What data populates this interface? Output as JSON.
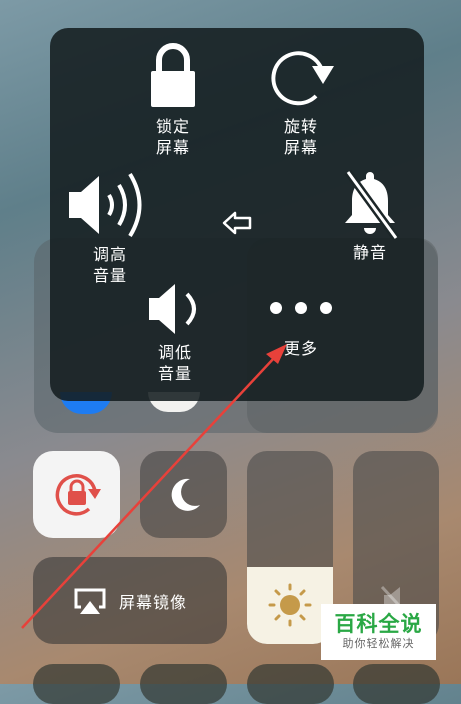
{
  "assistive_menu": {
    "lock_screen_label": "锁定\n屏幕",
    "rotate_screen_label": "旋转\n屏幕",
    "volume_up_label": "调高\n音量",
    "mute_label": "静音",
    "volume_down_label": "调低\n音量",
    "more_label": "更多"
  },
  "control_center": {
    "screen_mirroring_label": "屏幕镜像",
    "brightness_level": 0.4,
    "volume_level": 0.0
  },
  "watermark": {
    "title": "百科全说",
    "subtitle": "助你轻松解决"
  },
  "colors": {
    "annotation_arrow": "#e8413a",
    "rotation_lock_icon": "#e0504a",
    "watermark_green": "#2aa845"
  }
}
